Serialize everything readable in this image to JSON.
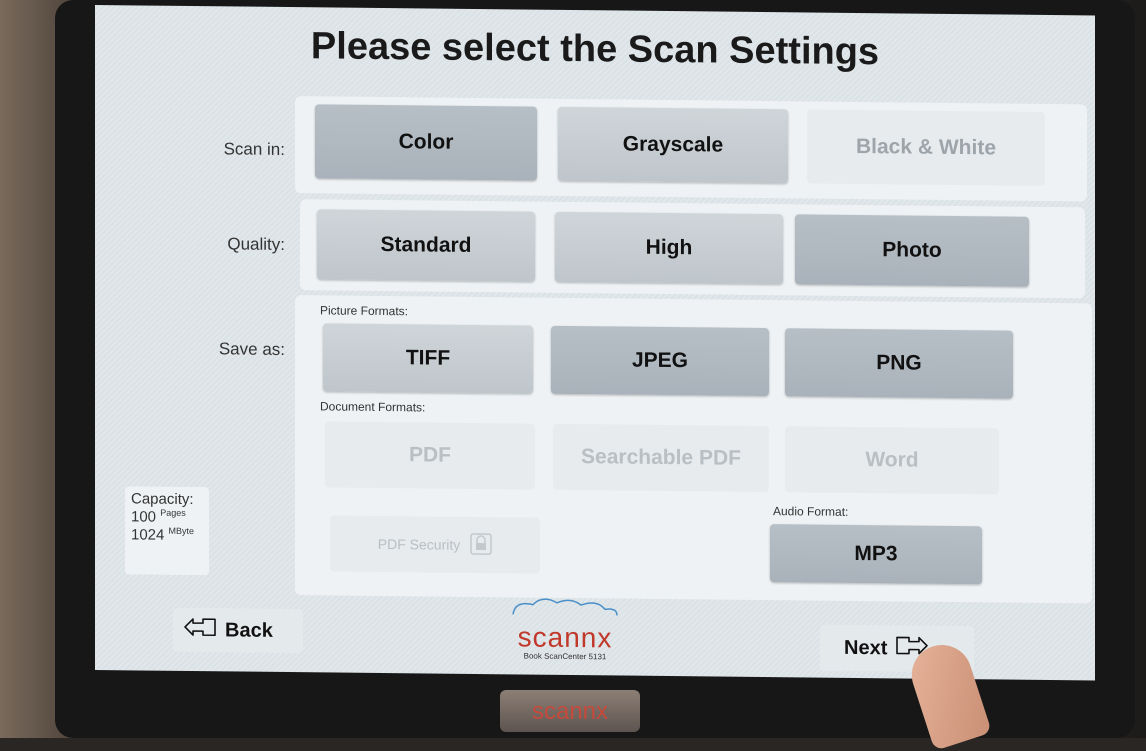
{
  "title": "Please select the Scan Settings",
  "scan_in": {
    "label": "Scan in:",
    "options": [
      "Color",
      "Grayscale",
      "Black & White"
    ]
  },
  "quality": {
    "label": "Quality:",
    "options": [
      "Standard",
      "High",
      "Photo"
    ]
  },
  "save_as": {
    "label": "Save as:",
    "picture_formats_label": "Picture Formats:",
    "picture_formats": [
      "TIFF",
      "JPEG",
      "PNG"
    ],
    "document_formats_label": "Document Formats:",
    "document_formats": [
      "PDF",
      "Searchable PDF",
      "Word"
    ],
    "pdf_security": "PDF Security",
    "audio_format_label": "Audio Format:",
    "audio_formats": [
      "MP3"
    ]
  },
  "capacity": {
    "label": "Capacity:",
    "pages_value": "100",
    "pages_unit": "Pages",
    "size_value": "1024",
    "size_unit": "MByte"
  },
  "nav": {
    "back": "Back",
    "next": "Next"
  },
  "logo": {
    "word": "scannx",
    "subtitle": "Book ScanCenter 5131"
  },
  "hardware_logo": "scannx",
  "colors": {
    "accent": "#c0392b",
    "screen_bg": "#dfe6ea"
  }
}
